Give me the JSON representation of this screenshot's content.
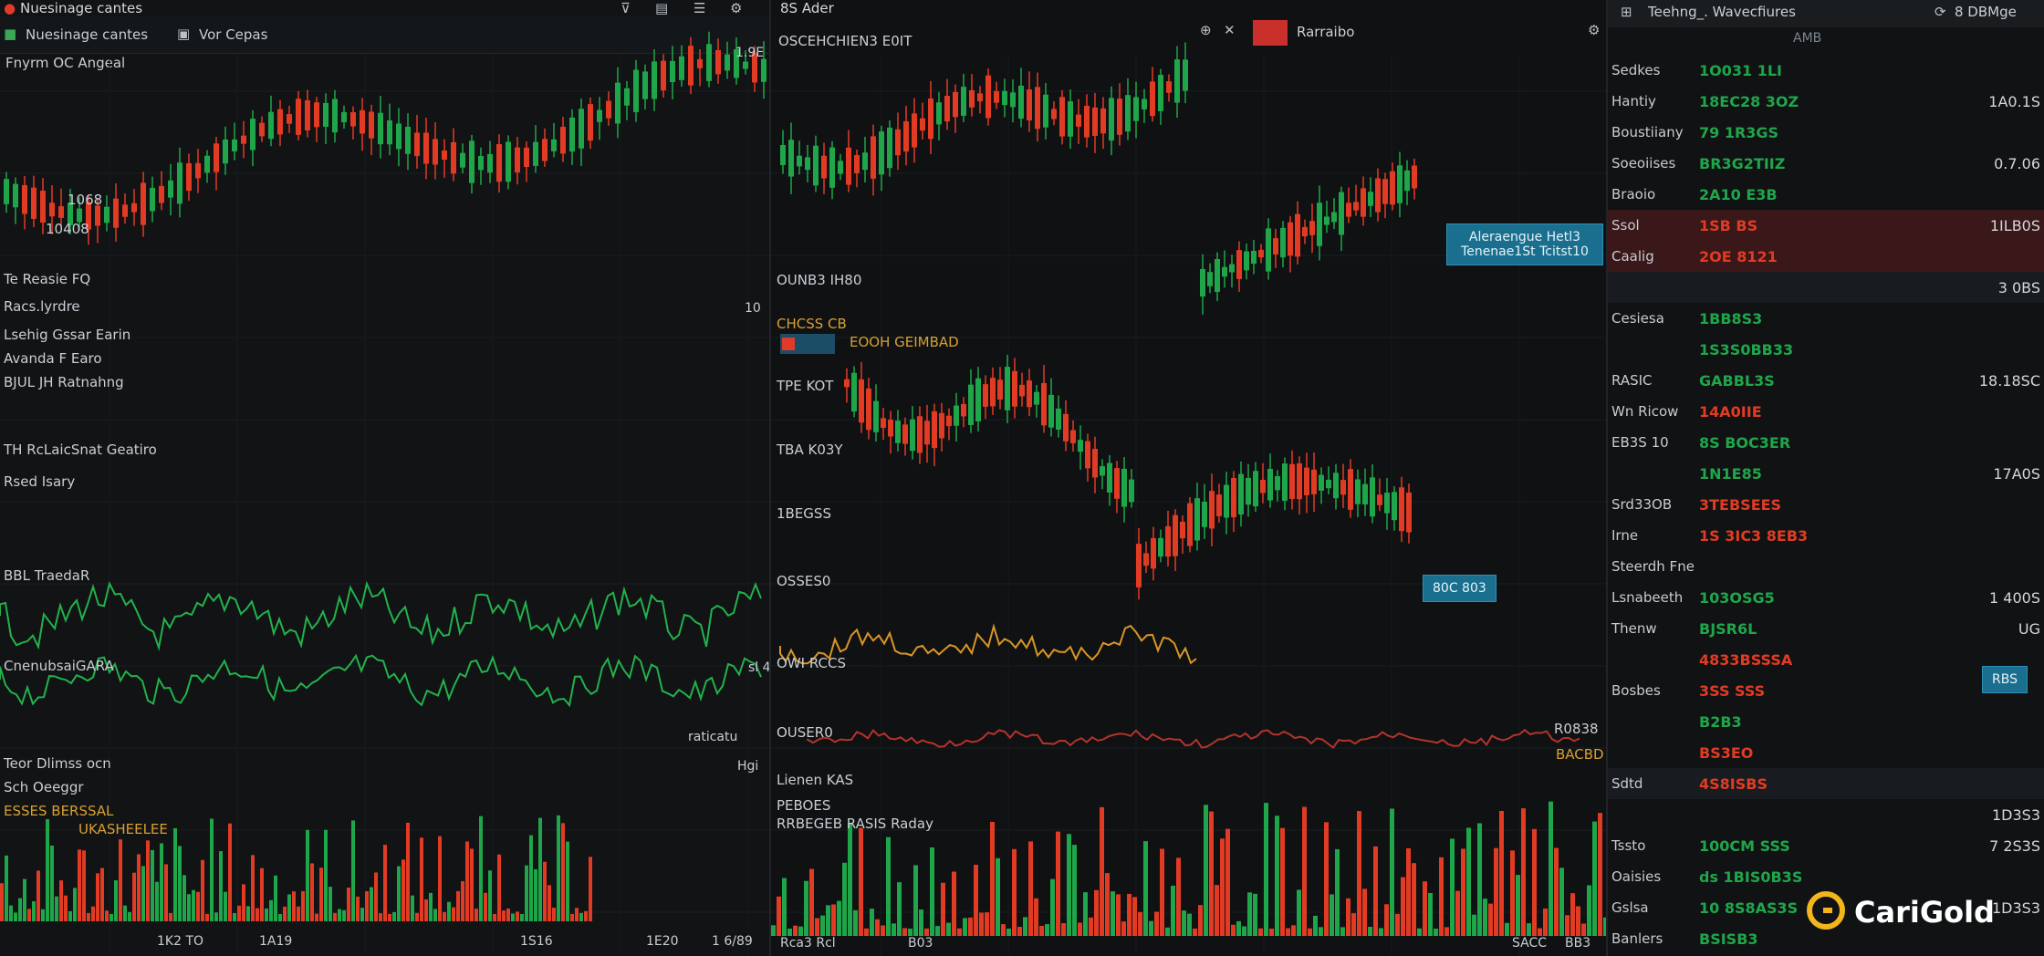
{
  "colors": {
    "up": "#1fa64a",
    "down": "#e23b24",
    "line_green": "#22b24c",
    "line_amber": "#d99626",
    "accent": "#1b6f8e",
    "logo": "#f2b61b"
  },
  "left_panel": {
    "window_title": "Nuesinage cantes",
    "tab_label": "Vor Cepas",
    "chart_title": "Fnyrm OC Angeal",
    "labels": [
      "1068",
      "10408",
      "Te Reasie FQ",
      "Racs.lyrdre",
      "Lsehig Gssar Earin",
      "Avanda F Earo",
      "BJUL JH Ratnahng",
      "TH RcLaicSnat Geatiro",
      "Rsed Isary",
      "BBL TraedaR",
      "CnenubsaiGARA",
      "Teor Dlimss ocn",
      "Sch Oeeggr",
      "ESSES BERSSAL",
      "UKASHEELEE"
    ],
    "axis_right": [
      "10",
      "1.9E",
      "sl 4",
      "raticatu",
      "Hgi"
    ],
    "bottom_axis": [
      "1K2 TO",
      "1A19",
      "1S16",
      "1E20",
      "1 6/89"
    ]
  },
  "middle_panel": {
    "top_label": "8S Ader",
    "subtitle": "OSCEHCHIEN3 E0IT",
    "header_tab": "Rarraibo",
    "labels": [
      "OUNB3 IH80",
      "CHCSS CB",
      "EOOH GEIMBAD",
      "TPE KOT",
      "TBA K03Y",
      "1BEGSS",
      "OSSES0",
      "OWI RCCS",
      "OUSER0",
      "Lienen KAS",
      "PEBOES",
      "RRBEGEB RASIS Raday"
    ],
    "tags": [
      "Aleraengue Hetl3 Tenenae1St Tcitst10",
      "80C 803"
    ],
    "right_labels": [
      "R0838",
      "BACBD"
    ],
    "bottom_axis": [
      "Rca3 Rcl",
      "B03",
      "SACC",
      "BB3"
    ]
  },
  "right_panel": {
    "title": "Teehng_. Wavecfiures",
    "header_right": "8 DBMge",
    "col_header": "AMB",
    "rows": [
      {
        "name": "Sedkes",
        "value": "1O031 1LI",
        "extra": "",
        "color": "up",
        "style": ""
      },
      {
        "name": "Hantiy",
        "value": "18EC28 3OZ",
        "extra": "1A0.1S",
        "color": "up",
        "style": ""
      },
      {
        "name": "Boustiiany",
        "value": "79 1R3GS",
        "extra": "",
        "color": "up",
        "style": ""
      },
      {
        "name": "Soeoiises",
        "value": "BR3G2TIIZ",
        "extra": "0.7.06",
        "color": "up",
        "style": ""
      },
      {
        "name": "Braoio",
        "value": "2A10 E3B",
        "extra": "",
        "color": "up",
        "style": ""
      },
      {
        "name": "Ssol",
        "value": "1SB BS",
        "extra": "1ILB0S",
        "color": "down",
        "style": "hl"
      },
      {
        "name": "Caalig",
        "value": "2OE 8121",
        "extra": "",
        "color": "down",
        "style": "hl"
      },
      {
        "name": "",
        "value": "",
        "extra": "3 0BS",
        "color": "up",
        "style": "dk"
      },
      {
        "name": "Cesiesa",
        "value": "1BB8S3",
        "extra": "",
        "color": "up",
        "style": ""
      },
      {
        "name": "",
        "value": "1S3S0BB33",
        "extra": "",
        "color": "up",
        "style": ""
      },
      {
        "name": "RASIC",
        "value": "GABBL3S",
        "extra": "18.18SC",
        "color": "up",
        "style": ""
      },
      {
        "name": "Wn Ricow",
        "value": "14A0IIE",
        "extra": "",
        "color": "down",
        "style": ""
      },
      {
        "name": "EB3S 10",
        "value": "8S BOC3ER",
        "extra": "",
        "color": "up",
        "style": ""
      },
      {
        "name": "",
        "value": "1N1E85",
        "extra": "17A0S",
        "color": "up",
        "style": ""
      },
      {
        "name": "Srd33OB",
        "value": "3TEBSEES",
        "extra": "",
        "color": "down",
        "style": ""
      },
      {
        "name": "Irne",
        "value": "1S 3IC3 8EB3",
        "extra": "",
        "color": "down",
        "style": ""
      },
      {
        "name": "Steerdh Fne",
        "value": "",
        "extra": "",
        "color": "up",
        "style": ""
      },
      {
        "name": "Lsnabeeth",
        "value": "103OSG5",
        "extra": "1 400S",
        "color": "up",
        "style": ""
      },
      {
        "name": "Thenw",
        "value": "BJSR6L",
        "extra": "UG",
        "color": "up",
        "style": ""
      },
      {
        "name": "",
        "value": "4833BSSSA",
        "extra": "",
        "color": "down",
        "style": ""
      },
      {
        "name": "Bosbes",
        "value": "3SS SSS",
        "extra": "",
        "color": "down",
        "style": ""
      },
      {
        "name": "",
        "value": "B2B3",
        "extra": "",
        "color": "up",
        "style": ""
      },
      {
        "name": "",
        "value": "BS3EO",
        "extra": "",
        "color": "down",
        "style": ""
      },
      {
        "name": "Sdtd",
        "value": "4S8ISBS",
        "extra": "",
        "color": "down",
        "style": "dk"
      },
      {
        "name": "",
        "value": "",
        "extra": "1D3S3",
        "color": "up",
        "style": ""
      },
      {
        "name": "Tssto",
        "value": "100CM SSS",
        "extra": "7 2S3S",
        "color": "up",
        "style": ""
      },
      {
        "name": "Oaisies",
        "value": "ds 1BIS0B3S",
        "extra": "",
        "color": "up",
        "style": ""
      },
      {
        "name": "Gslsa",
        "value": "10 8S8AS3S",
        "extra": "1D3S3",
        "color": "up",
        "style": ""
      },
      {
        "name": "Banlers",
        "value": "BSISB3",
        "extra": "",
        "color": "up",
        "style": ""
      }
    ],
    "side_tag": "RBS",
    "logo_text": "CariGold"
  }
}
